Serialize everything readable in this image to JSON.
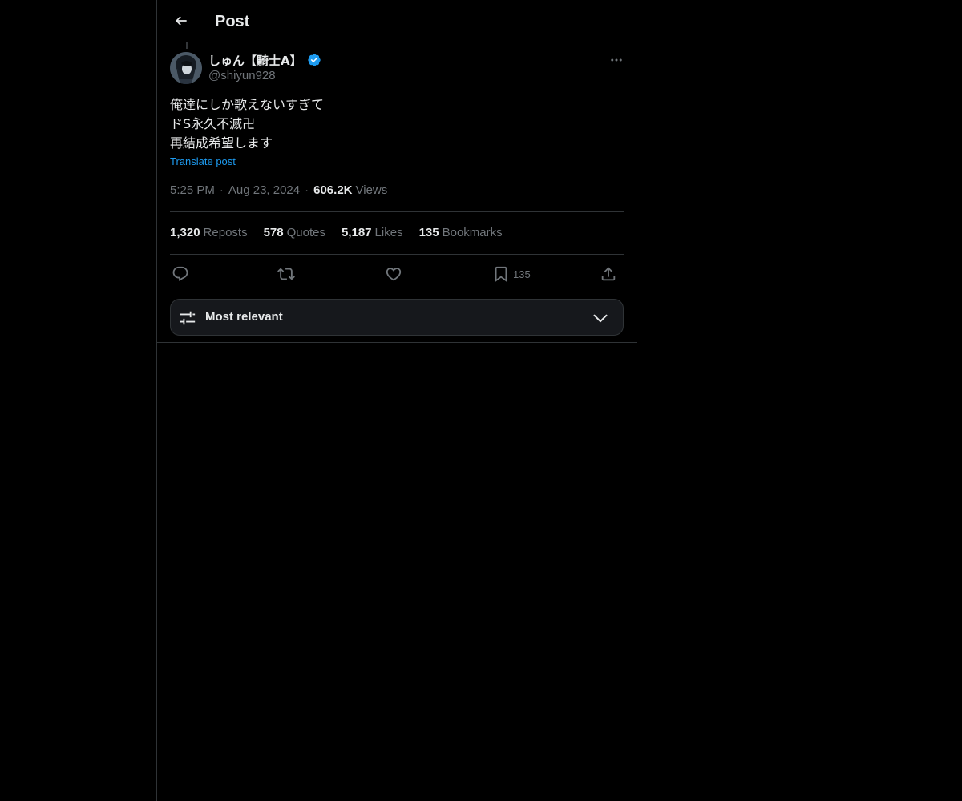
{
  "header": {
    "title": "Post",
    "back_icon": "arrow-left-icon"
  },
  "author": {
    "display_name": "しゅん【騎士A】",
    "handle": "@shiyun928",
    "verified_color": "#1d9bf0"
  },
  "post": {
    "lines": [
      "俺達にしか歌えないすぎて",
      "ドS永久不滅卍",
      "再結成希望します"
    ],
    "translate_label": "Translate post",
    "time": "5:25 PM",
    "date": "Aug 23, 2024",
    "views_count": "606.2K",
    "views_label": "Views"
  },
  "stats": {
    "reposts_count": "1,320",
    "reposts_label": "Reposts",
    "quotes_count": "578",
    "quotes_label": "Quotes",
    "likes_count": "5,187",
    "likes_label": "Likes",
    "bookmarks_count": "135",
    "bookmarks_label": "Bookmarks"
  },
  "actions": {
    "bookmark_count": "135"
  },
  "sort": {
    "label": "Most relevant"
  },
  "colors": {
    "background": "#000000",
    "text": "#e7e9ea",
    "secondary": "#71767b",
    "accent": "#1d9bf0",
    "border": "#2f3336"
  }
}
